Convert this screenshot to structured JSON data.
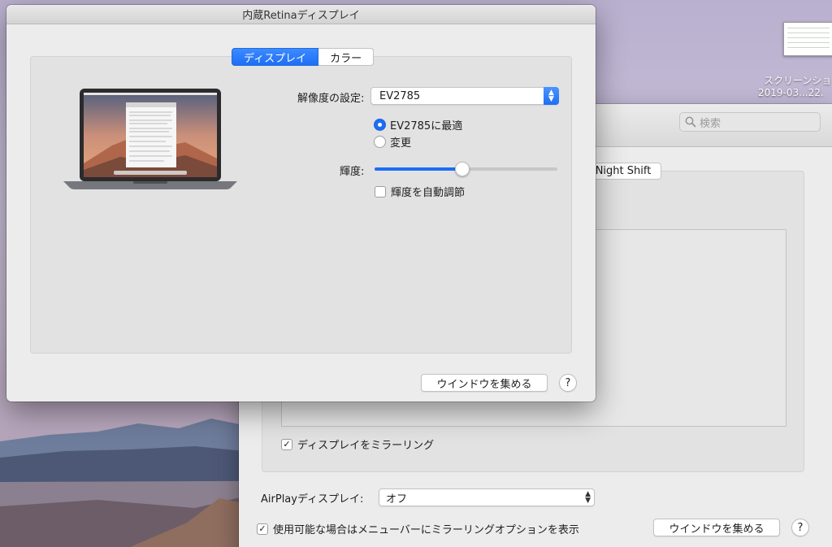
{
  "desktop": {
    "file_label_line1": "スクリーンショ",
    "file_label_line2": "2019-03...22."
  },
  "front_window": {
    "title": "内蔵Retinaディスプレイ",
    "tabs": [
      {
        "label": "ディスプレイ",
        "selected": true
      },
      {
        "label": "カラー",
        "selected": false
      }
    ],
    "resolution": {
      "label": "解像度の設定:",
      "selected_value": "EV2785",
      "options": [
        {
          "label": "EV2785に最適",
          "selected": true
        },
        {
          "label": "変更",
          "selected": false
        }
      ]
    },
    "brightness": {
      "label": "輝度:",
      "value_percent": 48,
      "auto_label": "輝度を自動調節",
      "auto_checked": false
    },
    "gather_windows_label": "ウインドウを集める",
    "help_label": "?"
  },
  "back_window": {
    "search_placeholder": "検索",
    "tab_label": "Night Shift",
    "mirror_label": "ディスプレイをミラーリング",
    "mirror_checked": true,
    "airplay_label": "AirPlayディスプレイ:",
    "airplay_value": "オフ",
    "show_mirroring_label": "使用可能な場合はメニューバーにミラーリングオプションを表示",
    "show_mirroring_checked": true,
    "gather_windows_label": "ウインドウを集める",
    "help_label": "?"
  },
  "colors": {
    "accent": "#1d6ef5",
    "window_bg": "#ececec",
    "panel_bg": "#e2e2e2"
  }
}
